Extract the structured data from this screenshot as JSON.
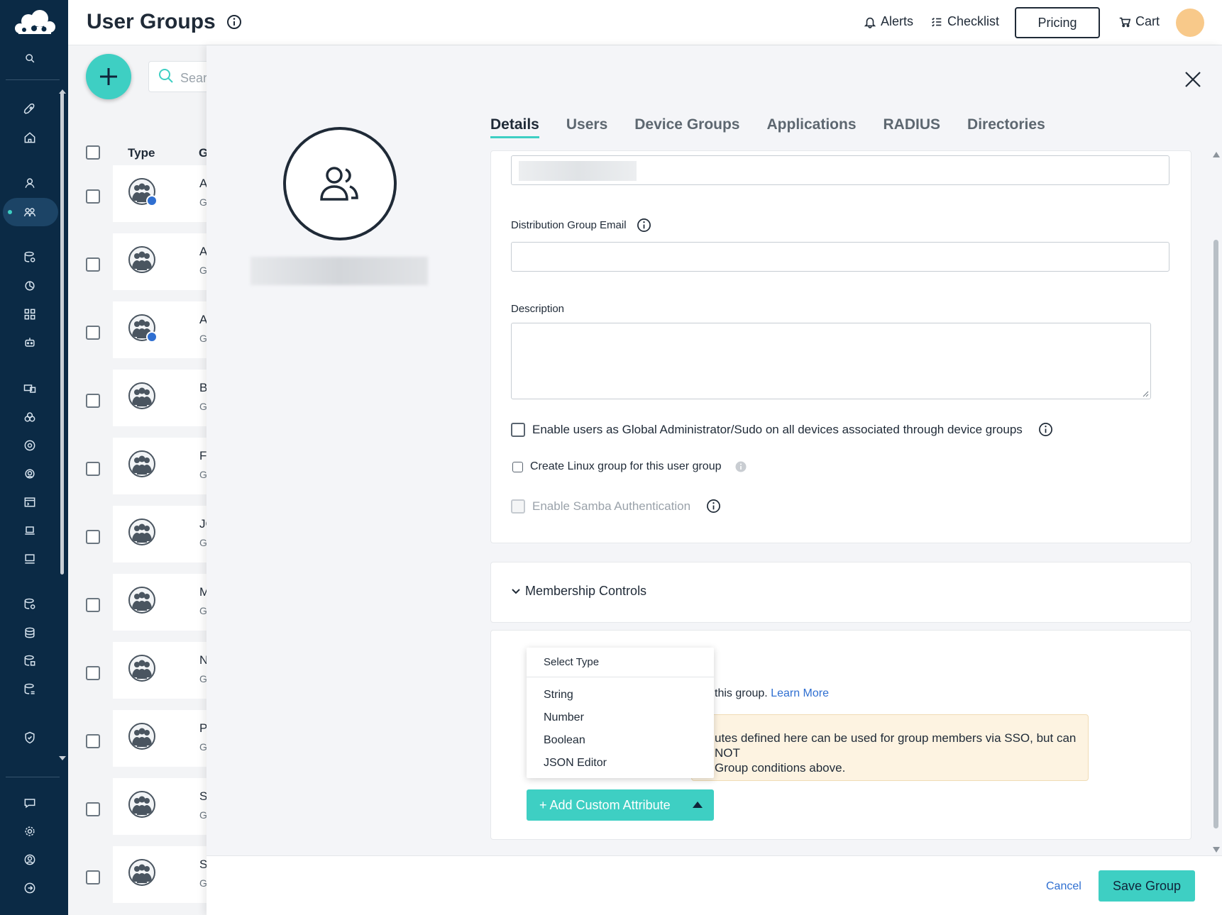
{
  "header": {
    "title": "User Groups",
    "alerts_label": "Alerts",
    "checklist_label": "Checklist",
    "pricing_label": "Pricing",
    "cart_label": "Cart"
  },
  "list": {
    "search_placeholder": "Search",
    "col_type": "Type",
    "col_group": "G",
    "rows": [
      {
        "a": "A",
        "b": "G",
        "windows_badge": true
      },
      {
        "a": "A",
        "b": "G",
        "windows_badge": false
      },
      {
        "a": "A",
        "b": "G",
        "windows_badge": true
      },
      {
        "a": "B",
        "b": "G",
        "windows_badge": false
      },
      {
        "a": "F",
        "b": "G",
        "windows_badge": false
      },
      {
        "a": "JC",
        "b": "G",
        "windows_badge": false
      },
      {
        "a": "M",
        "b": "G",
        "windows_badge": false
      },
      {
        "a": "N",
        "b": "G",
        "windows_badge": false
      },
      {
        "a": "P",
        "b": "G",
        "windows_badge": false
      },
      {
        "a": "S",
        "b": "G",
        "windows_badge": false
      },
      {
        "a": "S",
        "b": "G",
        "windows_badge": false
      }
    ]
  },
  "drawer": {
    "tabs": [
      "Details",
      "Users",
      "Device Groups",
      "Applications",
      "RADIUS",
      "Directories"
    ],
    "active_tab": "Details",
    "fields": {
      "distribution_email_label": "Distribution Group Email",
      "distribution_email_value": "",
      "description_label": "Description",
      "description_value": ""
    },
    "checkboxes": {
      "sudo_label": "Enable users as Global Administrator/Sudo on all devices associated through device groups",
      "linux_label": "Create Linux group for this user group",
      "samba_label": "Enable Samba Authentication"
    },
    "membership": {
      "title": "Membership Controls"
    },
    "custom_attributes": {
      "text_visible": "this group.",
      "learn_more": "Learn More",
      "warning_line1": "utes defined here can be used for group members via SSO, but can NOT",
      "warning_line2": "Group conditions above.",
      "menu_header": "Select Type",
      "menu_items": [
        "String",
        "Number",
        "Boolean",
        "JSON Editor"
      ],
      "add_button_label": "+ Add Custom Attribute"
    },
    "footer": {
      "cancel_label": "Cancel",
      "save_label": "Save Group"
    }
  },
  "colors": {
    "sidebar": "#0b2a45",
    "accent": "#3ecfc3",
    "link": "#2f6fd1",
    "warning_bg": "#fdf3e1"
  }
}
